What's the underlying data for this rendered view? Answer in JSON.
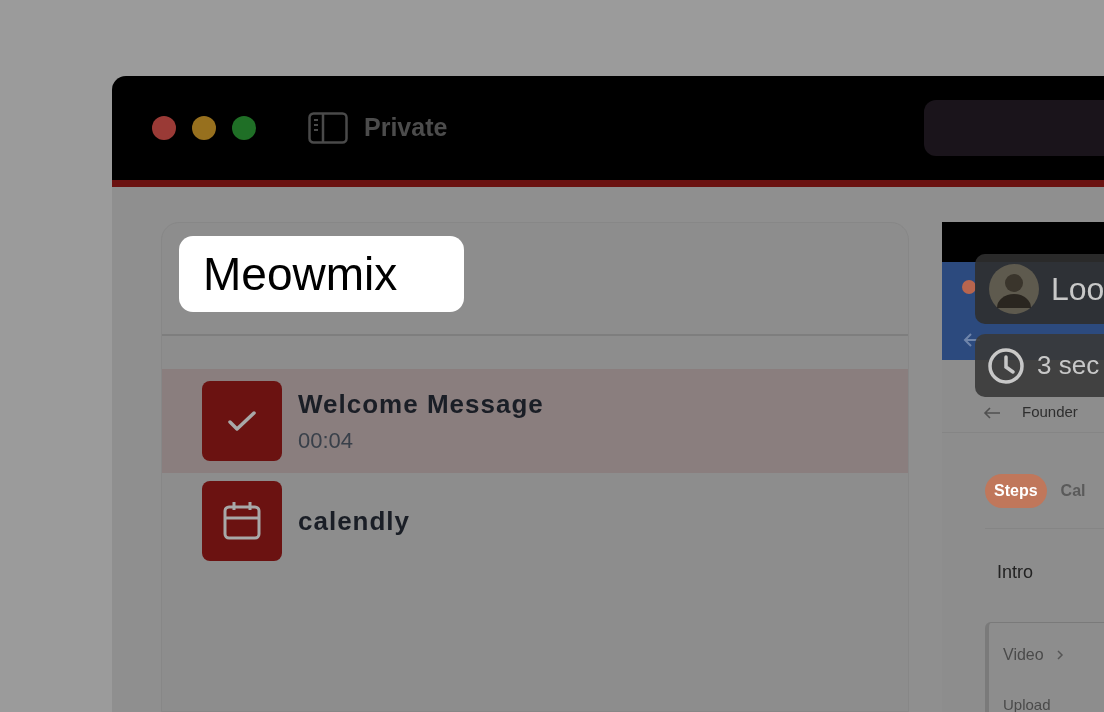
{
  "window": {
    "title": "Private"
  },
  "panel": {
    "title": "Meowmix"
  },
  "steps": [
    {
      "kind": "done",
      "title": "Welcome Message",
      "duration": "00:04",
      "selected": true
    },
    {
      "kind": "calendar",
      "title": "calendly",
      "selected": false
    }
  ],
  "preview": {
    "breadcrumb": "Founder",
    "tabs": [
      {
        "label": "Steps",
        "selected": true
      },
      {
        "label": "Cal",
        "selected": false
      }
    ],
    "section": "Intro",
    "path": "Video",
    "row": "Upload"
  },
  "recording": {
    "name": "Loo",
    "elapsed": "3 sec"
  }
}
